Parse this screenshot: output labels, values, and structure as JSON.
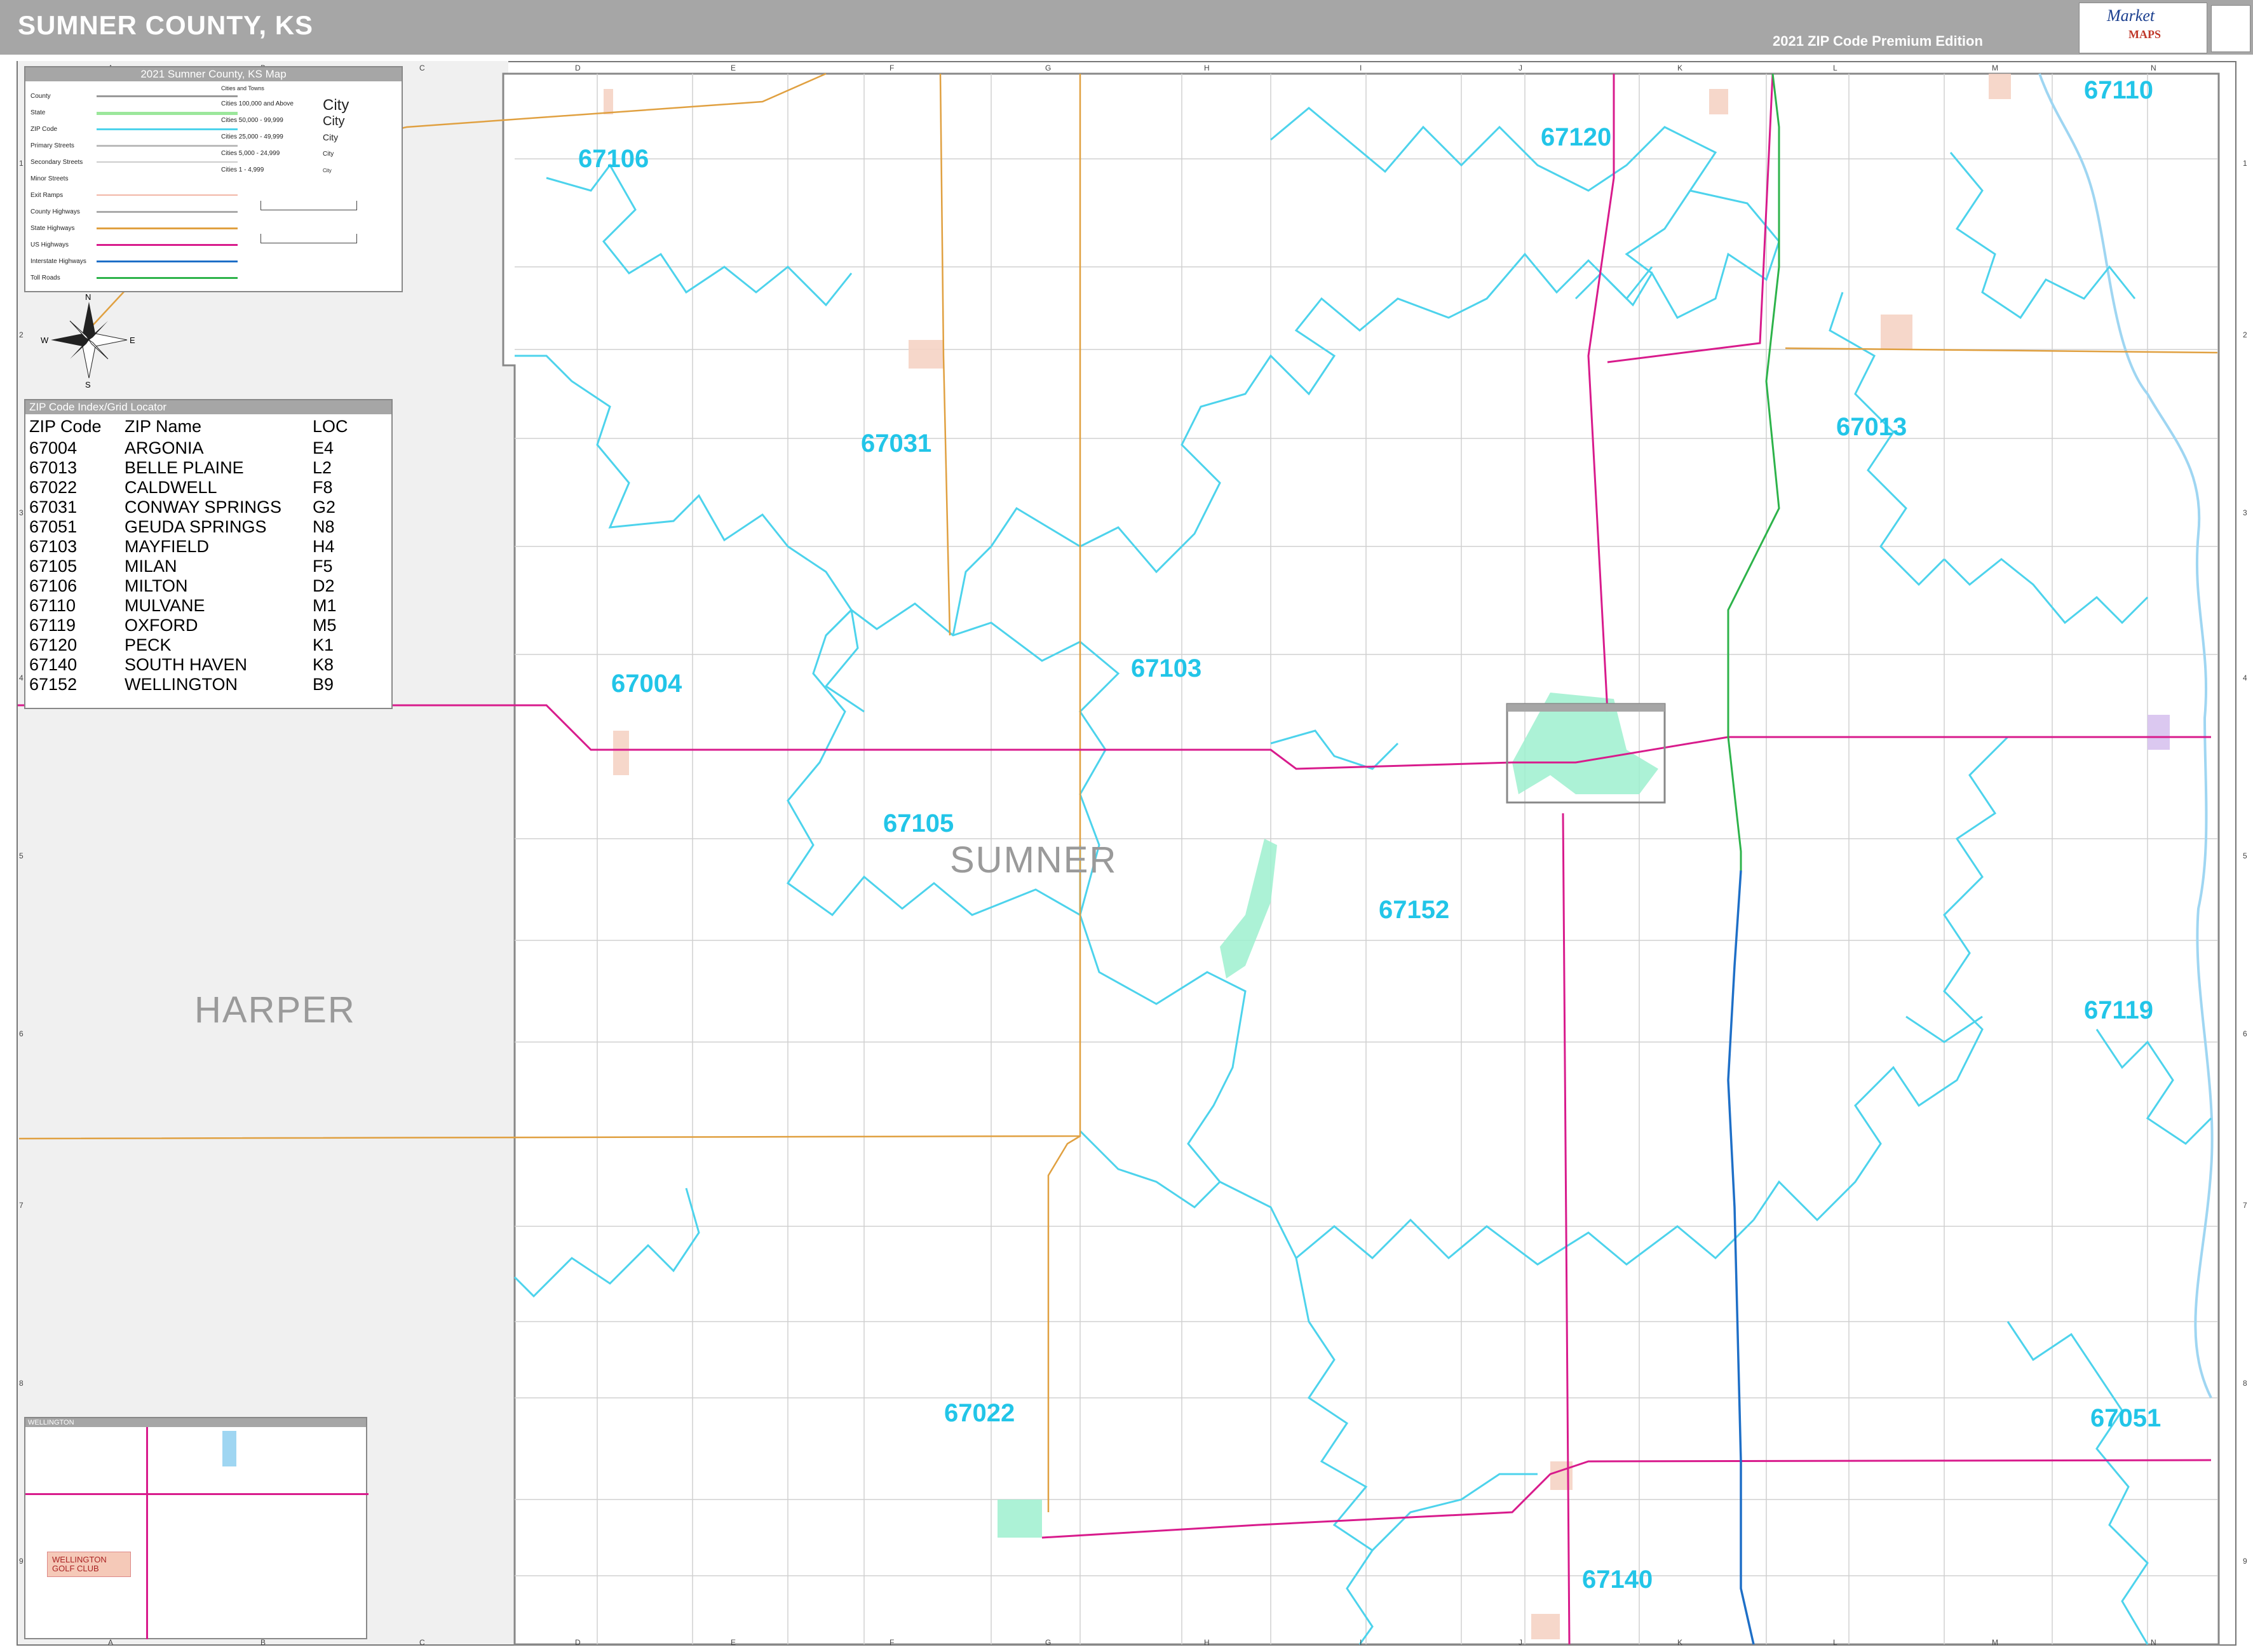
{
  "header": {
    "title": "SUMNER COUNTY, KS",
    "edition": "2021 ZIP Code Premium Edition",
    "logo_text": "Market",
    "logo_sub": "MAPS"
  },
  "legend": {
    "title": "2021 Sumner County, KS Map",
    "rows": [
      "County",
      "State",
      "ZIP Code",
      "Primary Streets",
      "Secondary Streets",
      "Minor Streets",
      "Exit Ramps",
      "County Highways",
      "State Highways",
      "US Highways",
      "Interstate Highways",
      "Toll Roads"
    ],
    "city_header": "Cities and Towns",
    "cities": [
      "Cities 100,000 and Above",
      "Cities 50,000 - 99,999",
      "Cities 25,000 - 49,999",
      "Cities 5,000 - 24,999",
      "Cities 1 - 4,999"
    ],
    "city_samples": [
      "City",
      "City",
      "City",
      "City",
      "City"
    ],
    "compass": {
      "n": "N",
      "s": "S",
      "e": "E",
      "w": "W"
    }
  },
  "zip_index": {
    "title": "ZIP Code Index/Grid Locator",
    "headers": [
      "ZIP Code",
      "ZIP Name",
      "LOC"
    ],
    "rows": [
      [
        "67004",
        "ARGONIA",
        "E4"
      ],
      [
        "67013",
        "BELLE PLAINE",
        "L2"
      ],
      [
        "67022",
        "CALDWELL",
        "F8"
      ],
      [
        "67031",
        "CONWAY SPRINGS",
        "G2"
      ],
      [
        "67051",
        "GEUDA SPRINGS",
        "N8"
      ],
      [
        "67103",
        "MAYFIELD",
        "H4"
      ],
      [
        "67105",
        "MILAN",
        "F5"
      ],
      [
        "67106",
        "MILTON",
        "D2"
      ],
      [
        "67110",
        "MULVANE",
        "M1"
      ],
      [
        "67119",
        "OXFORD",
        "M5"
      ],
      [
        "67120",
        "PECK",
        "K1"
      ],
      [
        "67140",
        "SOUTH HAVEN",
        "K8"
      ],
      [
        "67152",
        "WELLINGTON",
        "B9"
      ]
    ]
  },
  "map": {
    "zip_labels": [
      "67106",
      "67120",
      "67110",
      "67031",
      "67013",
      "67004",
      "67103",
      "67105",
      "67152",
      "67119",
      "67022",
      "67051",
      "67140"
    ],
    "county_labels": [
      "SUMNER",
      "HARPER"
    ],
    "grid_columns": [
      "A",
      "B",
      "C",
      "D",
      "E",
      "F",
      "G",
      "H",
      "I",
      "J",
      "K",
      "L",
      "M",
      "N"
    ],
    "grid_rows": [
      "1",
      "2",
      "3",
      "4",
      "5",
      "6",
      "7",
      "8",
      "9"
    ]
  },
  "inset": {
    "title": "WELLINGTON",
    "label": "WELLINGTON GOLF CLUB"
  },
  "colors": {
    "zip_boundary": "#4dd3ec",
    "us_highway": "#d81b8c",
    "state_highway": "#e0a040",
    "interstate": "#1e6fc7",
    "toll_road": "#2db34a",
    "city_area": "#9ef0cf",
    "header_gray": "#a6a6a6"
  }
}
